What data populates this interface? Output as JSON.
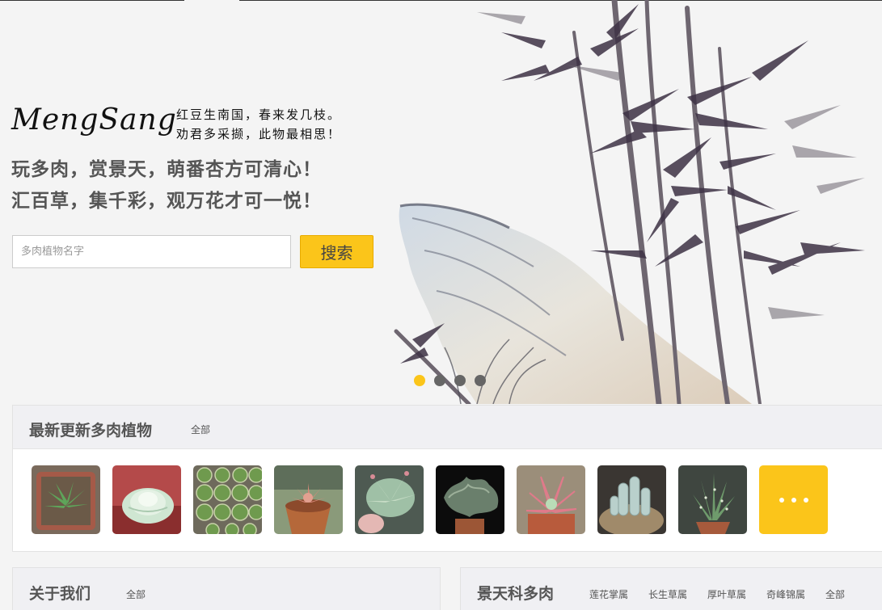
{
  "brand": {
    "logo": "MengSang",
    "poem_line1": "红豆生南国，春来发几枝。",
    "poem_line2": "劝君多采撷，此物最相思！"
  },
  "hero": {
    "slogan_line1": "玩多肉，赏景天，萌番杏方可清心！",
    "slogan_line2": "汇百草，集千彩，观万花才可一悦！"
  },
  "search": {
    "placeholder": "多肉植物名字",
    "value": "",
    "button_label": "搜索"
  },
  "carousel": {
    "slide_count": 4,
    "active_index": 0
  },
  "latest": {
    "title": "最新更新多肉植物",
    "all_link": "全部",
    "thumbnails": [
      {
        "name": "haworthia-cooperi"
      },
      {
        "name": "pale-green-echeveria"
      },
      {
        "name": "cactus-tray"
      },
      {
        "name": "red-rosette-in-pot"
      },
      {
        "name": "pink-tipped-echeveria"
      },
      {
        "name": "crested-succulent"
      },
      {
        "name": "pink-edged-echeveria"
      },
      {
        "name": "blue-finger-succulent"
      },
      {
        "name": "spotted-aloe"
      }
    ]
  },
  "about": {
    "title": "关于我们",
    "all_link": "全部"
  },
  "sedum": {
    "title": "景天科多肉",
    "genera": [
      "莲花掌属",
      "长生草属",
      "厚叶草属",
      "奇峰锦属"
    ],
    "all_link": "全部"
  },
  "colors": {
    "accent": "#fbc51a",
    "background": "#f4f4f4",
    "panel_header": "#f0f0f3",
    "text": "#555555"
  }
}
